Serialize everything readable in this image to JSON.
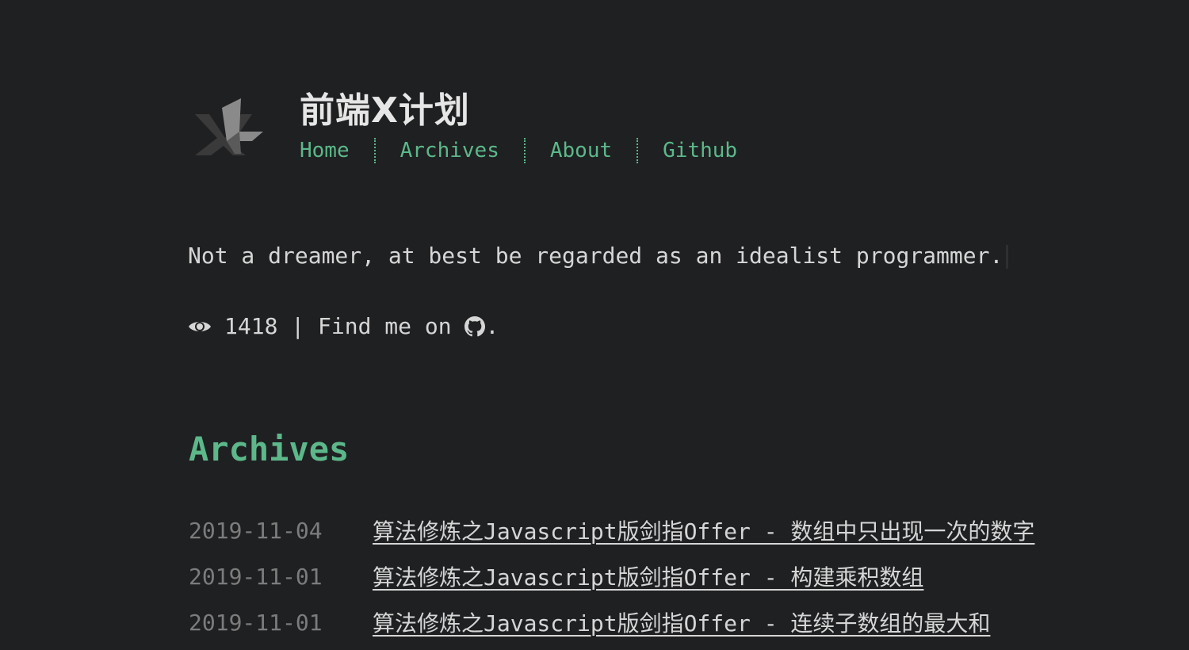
{
  "site": {
    "title": "前端X计划",
    "logo_icon": "x-logo-icon"
  },
  "nav": {
    "items": [
      {
        "label": "Home"
      },
      {
        "label": "Archives"
      },
      {
        "label": "About"
      },
      {
        "label": "Github"
      }
    ]
  },
  "intro": {
    "tagline": "Not a dreamer, at best be regarded as an idealist programmer.",
    "views_icon": "eye-icon",
    "views": "1418",
    "separator": " | ",
    "find_me": "Find me on ",
    "github_icon": "github-icon",
    "suffix": "."
  },
  "archives": {
    "heading": "Archives",
    "posts": [
      {
        "date": "2019-11-04",
        "title": "算法修炼之Javascript版剑指Offer - 数组中只出现一次的数字"
      },
      {
        "date": "2019-11-01",
        "title": "算法修炼之Javascript版剑指Offer - 构建乘积数组"
      },
      {
        "date": "2019-11-01",
        "title": "算法修炼之Javascript版剑指Offer - 连续子数组的最大和"
      }
    ]
  },
  "colors": {
    "background": "#1f2022",
    "accent": "#5cb88a",
    "text": "#d6d6d6",
    "muted": "#7c7c7c"
  }
}
